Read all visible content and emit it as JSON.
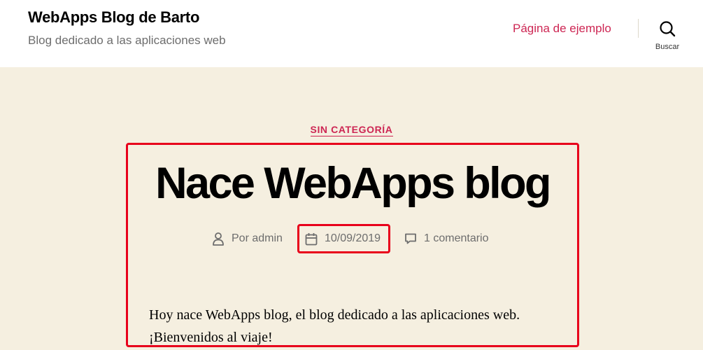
{
  "header": {
    "site_title": "WebApps Blog de Barto",
    "site_description": "Blog dedicado a las aplicaciones web",
    "nav_link": "Página de ejemplo",
    "search_label": "Buscar"
  },
  "post": {
    "category": "SIN CATEGORÍA",
    "title": "Nace WebApps blog",
    "author": "Por admin",
    "date": "10/09/2019",
    "comments": "1 comentario",
    "content_lines": [
      "Hoy nace WebApps blog, el blog dedicado a las aplicaciones web.",
      "¡Bienvenidos al viaje!"
    ]
  },
  "colors": {
    "accent": "#cd2653",
    "background": "#f5efe0",
    "highlight": "#e8001b"
  }
}
